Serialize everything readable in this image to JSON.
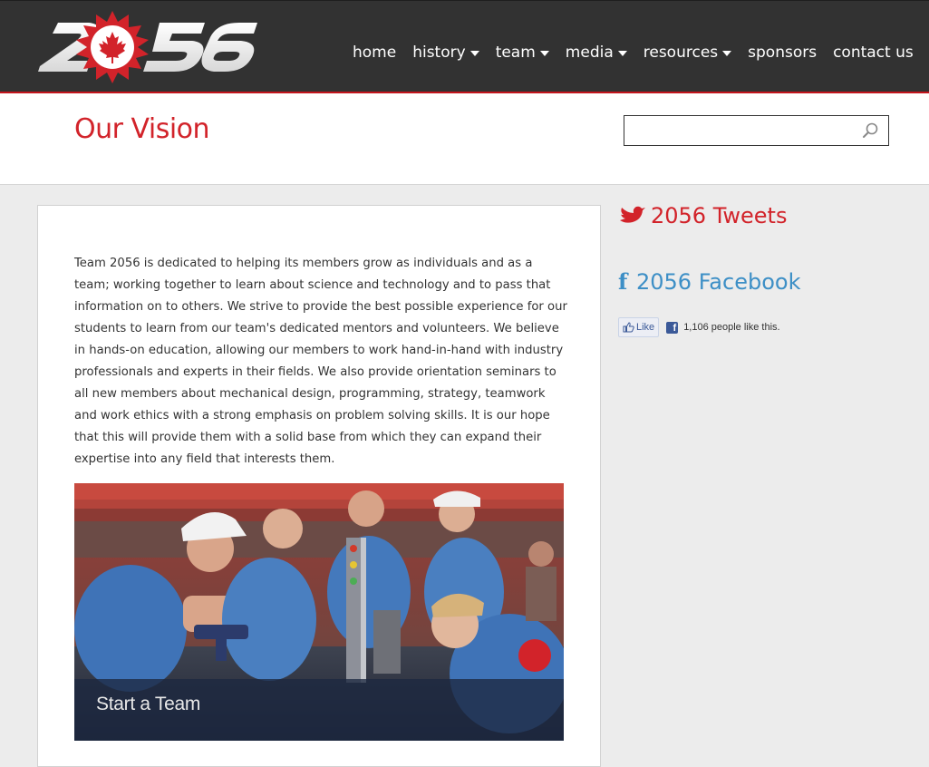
{
  "brand": {
    "logo_text": "2056",
    "colors": {
      "red": "#d2232a",
      "dark": "#323232",
      "facebook_blue": "#3d8fc6"
    }
  },
  "nav": {
    "items": [
      {
        "label": "home",
        "dropdown": false
      },
      {
        "label": "history",
        "dropdown": true
      },
      {
        "label": "team",
        "dropdown": true
      },
      {
        "label": "media",
        "dropdown": true
      },
      {
        "label": "resources",
        "dropdown": true
      },
      {
        "label": "sponsors",
        "dropdown": false
      },
      {
        "label": "contact us",
        "dropdown": false
      }
    ]
  },
  "page": {
    "title": "Our Vision"
  },
  "search": {
    "value": "",
    "placeholder": "",
    "icon": "magnifier-icon"
  },
  "main": {
    "body": "Team 2056 is dedicated to helping its members grow as individuals and as a team; working together to learn about science and technology and to pass that information on to others. We strive to provide the best possible experience for our students to learn from our team's dedicated mentors and volunteers. We believe in hands-on education, allowing our members to work hand-in-hand with industry professionals and experts in their fields. We also provide orientation seminars to all new members about mechanical design, programming, strategy, teamwork and work ethics with a strong emphasis on problem solving skills. It is our hope that this will provide them with a solid base from which they can expand their expertise into any field that interests them.",
    "photo_caption": "Start a Team"
  },
  "sidebar": {
    "tweets_heading": "2056 Tweets",
    "facebook_heading": "2056 Facebook",
    "like_button_label": "Like",
    "like_count_text": "1,106 people like this."
  }
}
